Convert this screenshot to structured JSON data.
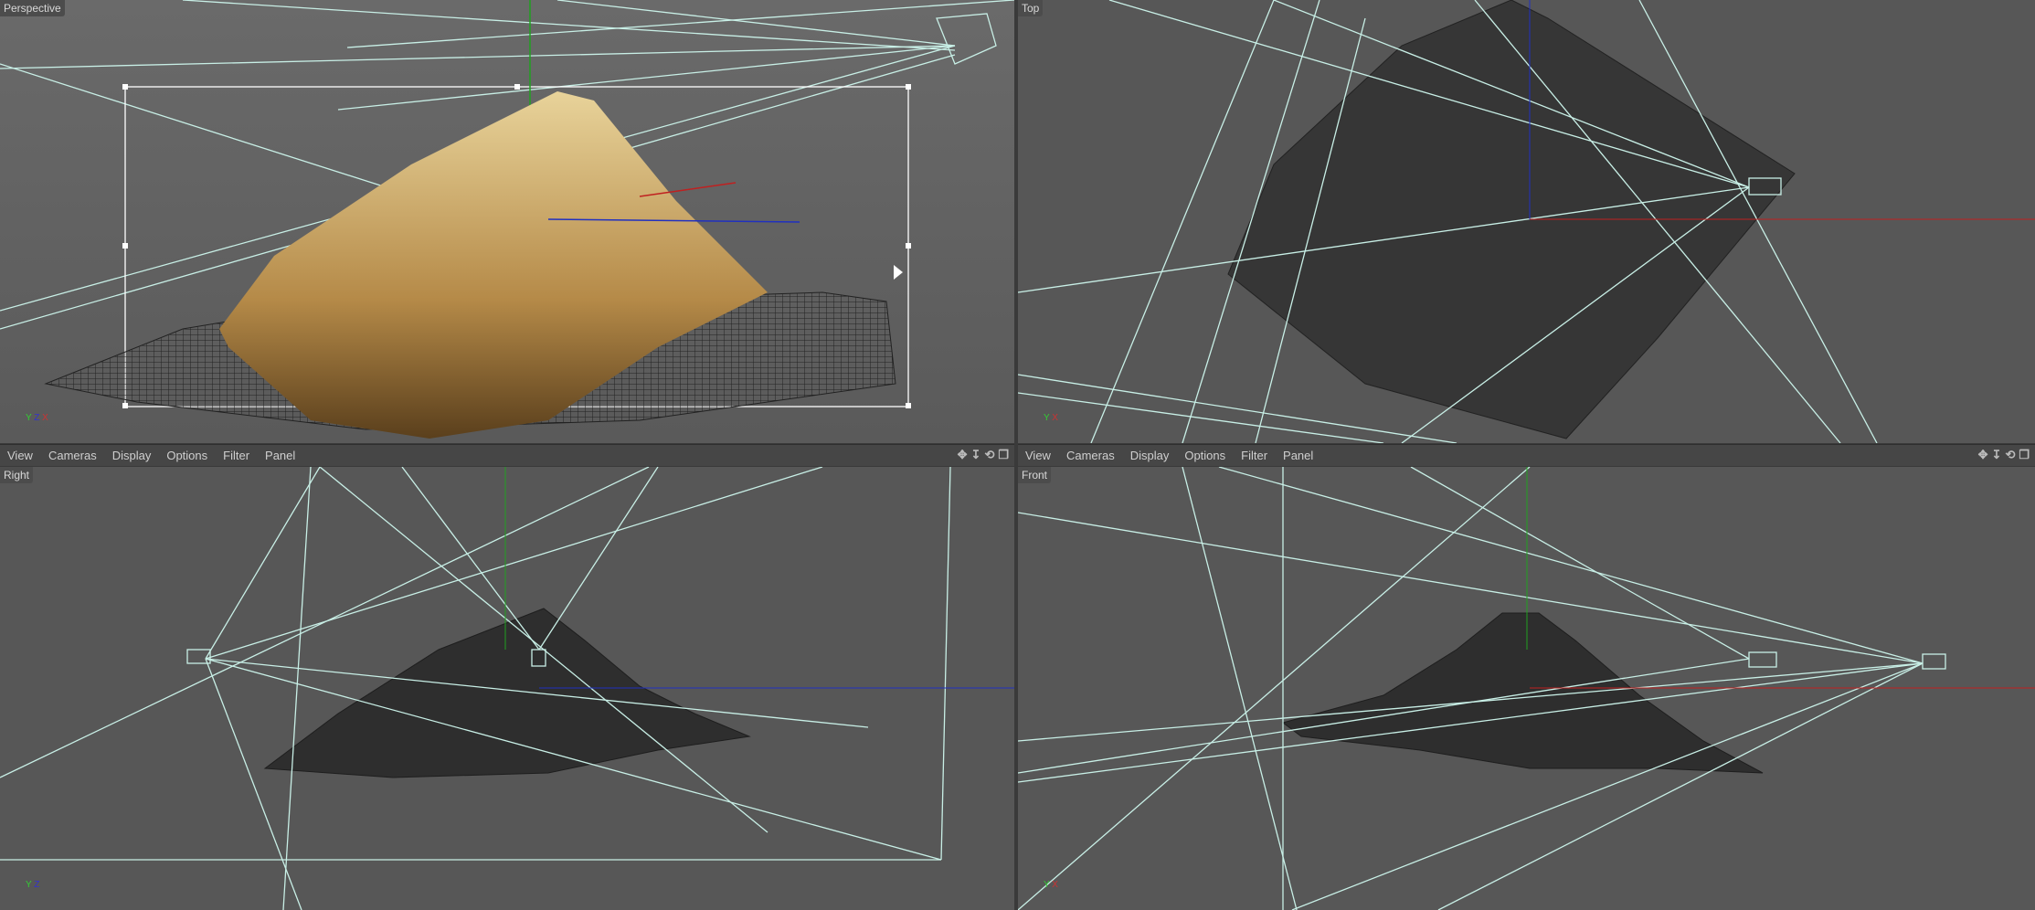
{
  "viewports": [
    {
      "label": "Perspective"
    },
    {
      "label": "Top"
    },
    {
      "label": "Right"
    },
    {
      "label": "Front"
    }
  ],
  "menu": {
    "items": [
      "View",
      "Cameras",
      "Display",
      "Options",
      "Filter",
      "Panel"
    ]
  },
  "icons": [
    "move-icon",
    "zoom-icon",
    "rotate-icon",
    "maximize-icon"
  ],
  "axes": {
    "x": "X",
    "y": "Y",
    "z": "Z"
  },
  "colors": {
    "background": "#575757",
    "wire": "#c8efe6",
    "x_axis": "#c02020",
    "y_axis": "#20a020",
    "z_axis": "#2030c0"
  }
}
